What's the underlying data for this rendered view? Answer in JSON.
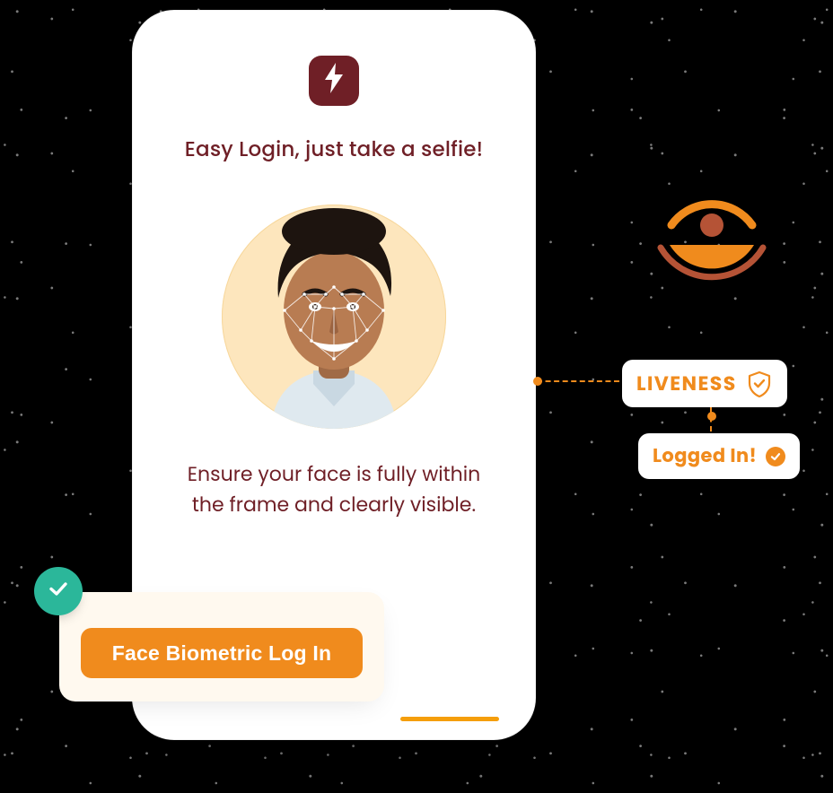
{
  "phone": {
    "headline": "Easy Login, just take a selfie!",
    "instruction": "Ensure your face is fully within the frame and clearly visible.",
    "brand_icon": "lightning-icon"
  },
  "panel": {
    "button_label": "Face Biometric Log In",
    "badge_icon": "check-icon"
  },
  "status": {
    "liveness_label": "LIVENESS",
    "loggedin_label": "Logged In!"
  },
  "colors": {
    "accent": "#f08b1d",
    "brand": "#6f1f26",
    "success": "#2bb79a",
    "panel_bg": "#fff9ef",
    "face_ring": "#fde6bd"
  }
}
